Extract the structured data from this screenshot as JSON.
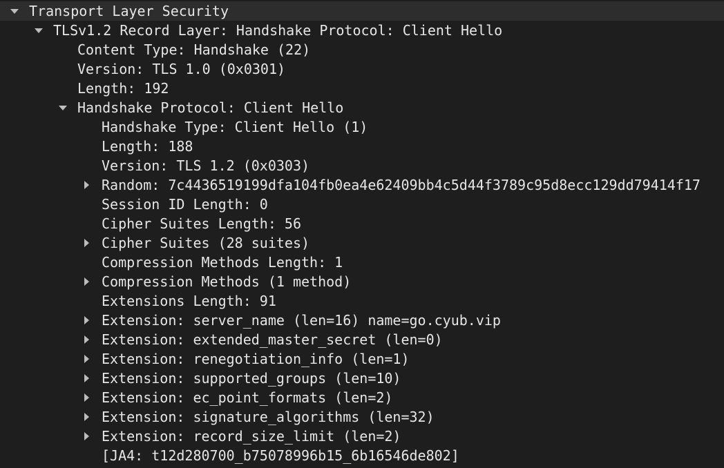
{
  "tree": [
    {
      "level": 0,
      "toggle": "expanded",
      "text": "Transport Layer Security",
      "icon": "chevron-down-icon"
    },
    {
      "level": 1,
      "toggle": "expanded",
      "text": "TLSv1.2 Record Layer: Handshake Protocol: Client Hello",
      "icon": "chevron-down-icon"
    },
    {
      "level": 2,
      "toggle": "none",
      "text": "Content Type: Handshake (22)"
    },
    {
      "level": 2,
      "toggle": "none",
      "text": "Version: TLS 1.0 (0x0301)"
    },
    {
      "level": 2,
      "toggle": "none",
      "text": "Length: 192"
    },
    {
      "level": 2,
      "toggle": "expanded",
      "text": "Handshake Protocol: Client Hello",
      "icon": "chevron-down-icon"
    },
    {
      "level": 3,
      "toggle": "none",
      "text": "Handshake Type: Client Hello (1)"
    },
    {
      "level": 3,
      "toggle": "none",
      "text": "Length: 188"
    },
    {
      "level": 3,
      "toggle": "none",
      "text": "Version: TLS 1.2 (0x0303)"
    },
    {
      "level": 3,
      "toggle": "collapsed",
      "text": "Random: 7c4436519199dfa104fb0ea4e62409bb4c5d44f3789c95d8ecc129dd79414f17",
      "icon": "chevron-right-icon"
    },
    {
      "level": 3,
      "toggle": "none",
      "text": "Session ID Length: 0"
    },
    {
      "level": 3,
      "toggle": "none",
      "text": "Cipher Suites Length: 56"
    },
    {
      "level": 3,
      "toggle": "collapsed",
      "text": "Cipher Suites (28 suites)",
      "icon": "chevron-right-icon"
    },
    {
      "level": 3,
      "toggle": "none",
      "text": "Compression Methods Length: 1"
    },
    {
      "level": 3,
      "toggle": "collapsed",
      "text": "Compression Methods (1 method)",
      "icon": "chevron-right-icon"
    },
    {
      "level": 3,
      "toggle": "none",
      "text": "Extensions Length: 91"
    },
    {
      "level": 3,
      "toggle": "collapsed",
      "text": "Extension: server_name (len=16) name=go.cyub.vip",
      "icon": "chevron-right-icon"
    },
    {
      "level": 3,
      "toggle": "collapsed",
      "text": "Extension: extended_master_secret (len=0)",
      "icon": "chevron-right-icon"
    },
    {
      "level": 3,
      "toggle": "collapsed",
      "text": "Extension: renegotiation_info (len=1)",
      "icon": "chevron-right-icon"
    },
    {
      "level": 3,
      "toggle": "collapsed",
      "text": "Extension: supported_groups (len=10)",
      "icon": "chevron-right-icon"
    },
    {
      "level": 3,
      "toggle": "collapsed",
      "text": "Extension: ec_point_formats (len=2)",
      "icon": "chevron-right-icon"
    },
    {
      "level": 3,
      "toggle": "collapsed",
      "text": "Extension: signature_algorithms (len=32)",
      "icon": "chevron-right-icon"
    },
    {
      "level": 3,
      "toggle": "collapsed",
      "text": "Extension: record_size_limit (len=2)",
      "icon": "chevron-right-icon"
    },
    {
      "level": 3,
      "toggle": "none",
      "text": "[JA4: t12d280700_b75078996b15_6b16546de802]"
    }
  ],
  "colors": {
    "background": "#1e1e1e",
    "text": "#e6e6e6",
    "toggle": "#bdbdbd",
    "hover_row": "#2d2d2d"
  }
}
